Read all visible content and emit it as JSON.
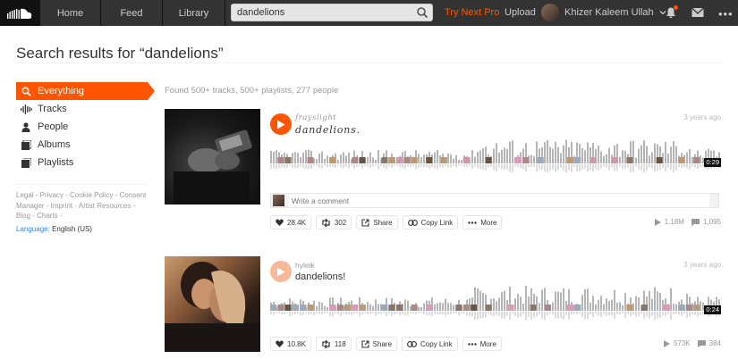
{
  "nav": {
    "home": "Home",
    "feed": "Feed",
    "library": "Library",
    "search_value": "dandelions",
    "try_pro": "Try Next Pro",
    "upload": "Upload",
    "user_name": "Khizer Kaleem Ullah",
    "more": "•••"
  },
  "page": {
    "title": "Search results for “dandelions”",
    "found_text": "Found 500+ tracks, 500+ playlists, 277 people"
  },
  "filters": [
    {
      "label": "Everything",
      "icon": "search-icon",
      "active": true
    },
    {
      "label": "Tracks",
      "icon": "waveform-icon",
      "active": false
    },
    {
      "label": "People",
      "icon": "person-icon",
      "active": false
    },
    {
      "label": "Albums",
      "icon": "album-icon",
      "active": false
    },
    {
      "label": "Playlists",
      "icon": "playlist-icon",
      "active": false
    }
  ],
  "footer": {
    "legal": "Legal - Privacy - Cookie Policy - Consent Manager - Imprint - Artist Resources - Blog - Charts -",
    "language_label": "Language:",
    "language_value": "English (US)"
  },
  "tracks": [
    {
      "username": "frayslight",
      "title": "dandelions.",
      "ago": "3 years ago",
      "duration": "0:29",
      "comment_placeholder": "Write a comment",
      "likes": "28.4K",
      "reposts": "302",
      "share": "Share",
      "copy_link": "Copy Link",
      "more": "More",
      "plays": "1.18M",
      "comments": "1,095"
    },
    {
      "username": "hyleik",
      "title": "dandelions!",
      "ago": "3 years ago",
      "duration": "0:24",
      "likes": "10.8K",
      "reposts": "118",
      "share": "Share",
      "copy_link": "Copy Link",
      "more": "More",
      "plays": "573K",
      "comments": "384"
    }
  ],
  "colors": {
    "accent": "#ff5500",
    "topbar": "#333333",
    "waveform": "#bbbbbb"
  }
}
